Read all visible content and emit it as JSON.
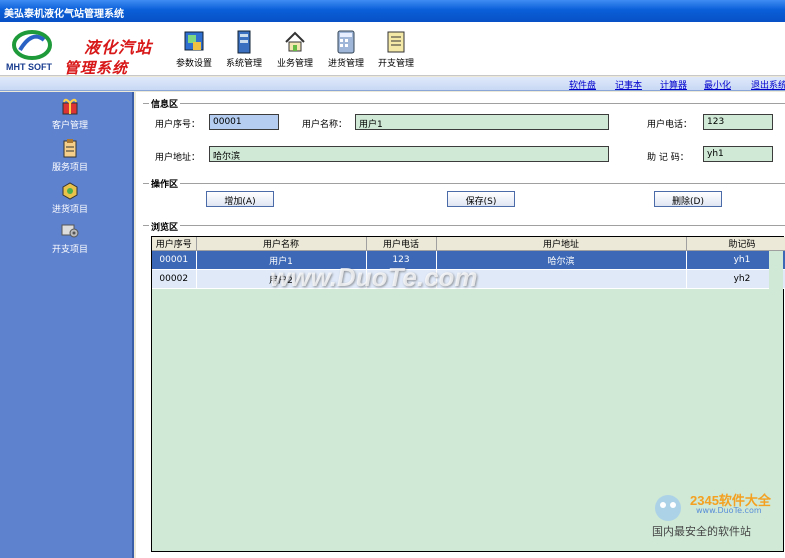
{
  "window": {
    "title": "美弘泰机液化气站管理系统"
  },
  "logo": {
    "text": "MHT SOFT"
  },
  "brand": {
    "line1": "液化汽站",
    "line2": "管理系统"
  },
  "toolbar": [
    {
      "label": "参数设置",
      "icon": "settings-icon"
    },
    {
      "label": "系统管理",
      "icon": "system-icon"
    },
    {
      "label": "业务管理",
      "icon": "home-icon"
    },
    {
      "label": "进货管理",
      "icon": "calculator-icon"
    },
    {
      "label": "开支管理",
      "icon": "ledger-icon"
    }
  ],
  "links": [
    "软件盘",
    "记事本",
    "计算器",
    "最小化",
    "退出系统"
  ],
  "sidebar": [
    {
      "label": "客户管理",
      "icon": "gift-icon"
    },
    {
      "label": "服务项目",
      "icon": "clipboard-icon"
    },
    {
      "label": "进货项目",
      "icon": "box-icon"
    },
    {
      "label": "开支项目",
      "icon": "gear-icon"
    }
  ],
  "info": {
    "title": "信息区",
    "id_label": "用户序号：",
    "id_value": "00001",
    "name_label": "用户名称：",
    "name_value": "用户1",
    "phone_label": "用户电话：",
    "phone_value": "123",
    "address_label": "用户地址：",
    "address_value": "哈尔滨",
    "code_label": "助 记 码：",
    "code_value": "yh1"
  },
  "ops": {
    "title": "操作区",
    "add": "增加(A)",
    "save": "保存(S)",
    "delete": "删除(D)"
  },
  "browse": {
    "title": "浏览区",
    "columns": [
      "用户序号",
      "用户名称",
      "用户电话",
      "用户地址",
      "助记码"
    ],
    "rows": [
      [
        "00001",
        "用户1",
        "123",
        "哈尔滨",
        "yh1"
      ],
      [
        "00002",
        "用户2",
        "",
        "",
        "yh2"
      ]
    ]
  },
  "watermark": {
    "main": "www.DuoTe.com",
    "badge": "2345软件大全",
    "site": "www.DuoTe.com",
    "slogan": "国内最安全的软件站"
  },
  "colors": {
    "titlebar": "#0a5fd8",
    "sidebar": "#5f82cf",
    "field": "#cfe9d6",
    "selected_row": "#3d68b6",
    "brand_red": "#d81818"
  }
}
